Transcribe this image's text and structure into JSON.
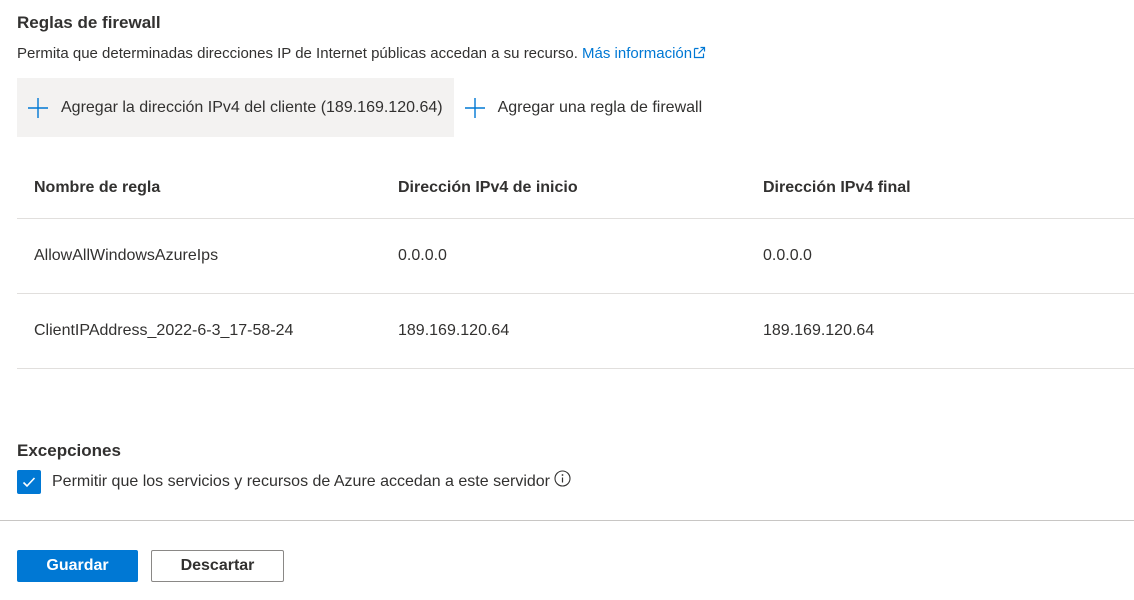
{
  "firewall": {
    "title": "Reglas de firewall",
    "description": "Permita que determinadas direcciones IP de Internet públicas accedan a su recurso.",
    "learn_more": "Más información"
  },
  "toolbar": {
    "add_client_ip": "Agregar la dirección IPv4 del cliente (189.169.120.64)",
    "add_rule": "Agregar una regla de firewall"
  },
  "table": {
    "headers": [
      "Nombre de regla",
      "Dirección IPv4 de inicio",
      "Dirección IPv4 final"
    ],
    "rows": [
      [
        "AllowAllWindowsAzureIps",
        "0.0.0.0",
        "0.0.0.0"
      ],
      [
        "ClientIPAddress_2022-6-3_17-58-24",
        "189.169.120.64",
        "189.169.120.64"
      ]
    ]
  },
  "exceptions": {
    "title": "Excepciones",
    "allow_azure_label": "Permitir que los servicios y recursos de Azure accedan a este servidor",
    "allow_azure_checked": true
  },
  "actions": {
    "save": "Guardar",
    "discard": "Descartar"
  },
  "icons": {
    "add": "plus-icon",
    "external": "external-link-icon",
    "info": "info-icon",
    "check": "checkmark-icon"
  },
  "colors": {
    "accent": "#0078d4",
    "text": "#323130",
    "toolbar_hover": "#f3f2f1",
    "border": "#e1dfdd"
  }
}
